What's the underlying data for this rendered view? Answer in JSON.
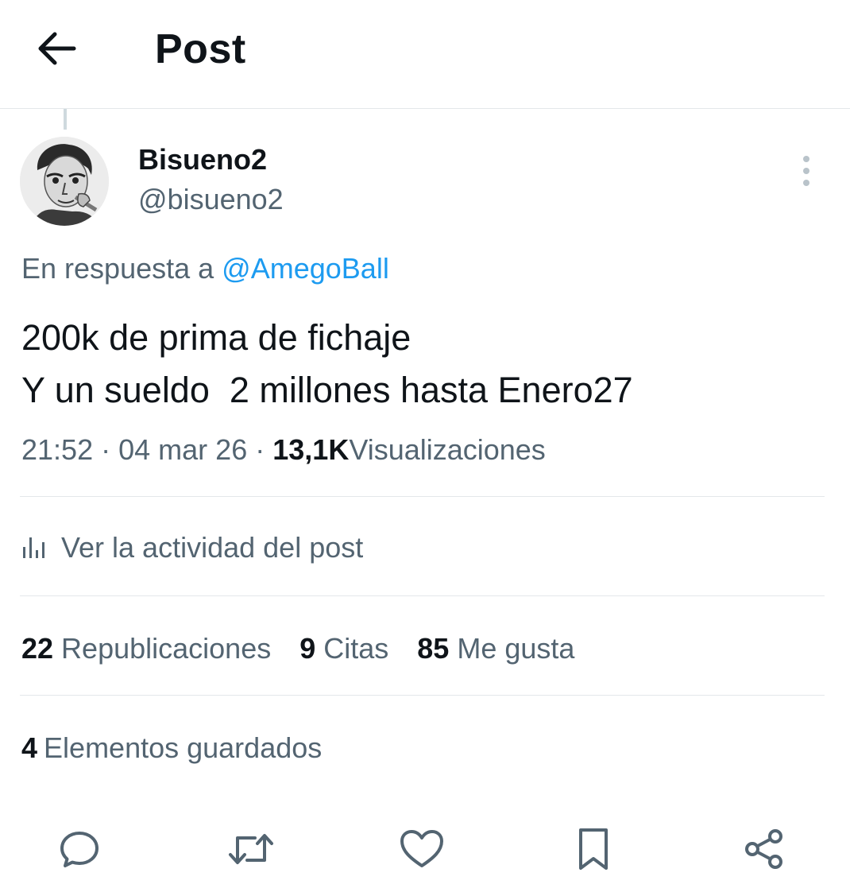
{
  "header": {
    "title": "Post",
    "back_icon": "arrow-left-icon"
  },
  "author": {
    "display_name": "Bisueno2",
    "handle": "@bisueno2",
    "avatar": "avatar-sketch-portrait"
  },
  "reply": {
    "prefix": "En respuesta a",
    "target": "@AmegoBall"
  },
  "post": {
    "lines": [
      "200k de prima de fichaje",
      "Y un sueldo  2 millones hasta Enero27"
    ],
    "time": "21:52",
    "date": "04 mar 26",
    "separator": "·",
    "views_count": "13,1K",
    "views_label": "Visualizaciones"
  },
  "activity": {
    "label": "Ver la actividad del post",
    "icon": "analytics-bars-icon"
  },
  "stats": {
    "reposts_count": "22",
    "reposts_label": "Republicaciones",
    "quotes_count": "9",
    "quotes_label": "Citas",
    "likes_count": "85",
    "likes_label": "Me gusta",
    "bookmarks_count": "4",
    "bookmarks_label": "Elementos guardados"
  },
  "actions": [
    "reply-icon",
    "repost-icon",
    "like-icon",
    "bookmark-icon",
    "share-icon"
  ],
  "colors": {
    "text_primary": "#0f1419",
    "text_secondary": "#536471",
    "link": "#1d9bf0",
    "divider": "#e3e7ea"
  }
}
